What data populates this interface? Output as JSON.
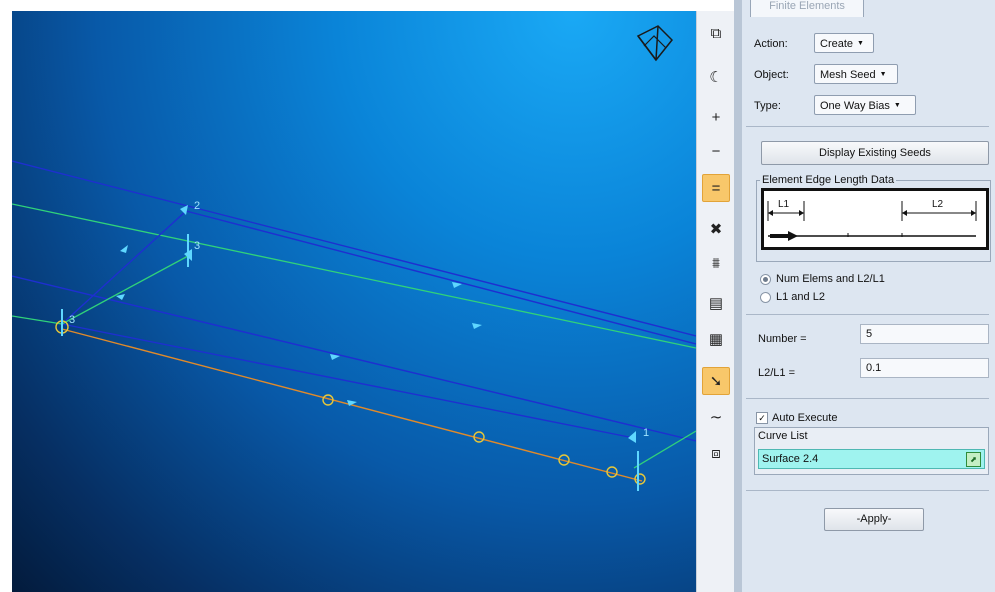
{
  "panel": {
    "tab_label": "Finite Elements",
    "action_label": "Action:",
    "action_value": "Create",
    "object_label": "Object:",
    "object_value": "Mesh Seed",
    "type_label": "Type:",
    "type_value": "One Way Bias",
    "display_seeds_button": "Display Existing Seeds",
    "edge_group_title": "Element Edge Length Data",
    "diagram_l1": "L1",
    "diagram_l2": "L2",
    "radio_option_1": "Num Elems and L2/L1",
    "radio_option_2": "L1 and L2",
    "radio_selected": 1,
    "number_label": "Number =",
    "number_value": "5",
    "ratio_label": "L2/L1 =",
    "ratio_value": "0.1",
    "auto_execute_label": "Auto Execute",
    "auto_execute_checked": true,
    "check_mark": "✓",
    "curve_list_label": "Curve List",
    "curve_list_value": "Surface 2.4",
    "apply_button": "-Apply-"
  },
  "viewport": {
    "node_labels": [
      "2",
      "3",
      "3",
      "1"
    ]
  },
  "toolbar": {
    "icons": [
      "copy-icon",
      "lasso-icon",
      "zoom-in-icon",
      "zoom-out-icon",
      "equal-icon",
      "tools-icon",
      "filter-icon",
      "list-view-icon",
      "element-list-icon",
      "pointer-icon",
      "curve-icon",
      "select-icon"
    ]
  },
  "colors": {
    "accent_button": "#f8c76a",
    "curve_list_bg": "#9ff3ef",
    "panel_bg": "#dde6f1"
  }
}
